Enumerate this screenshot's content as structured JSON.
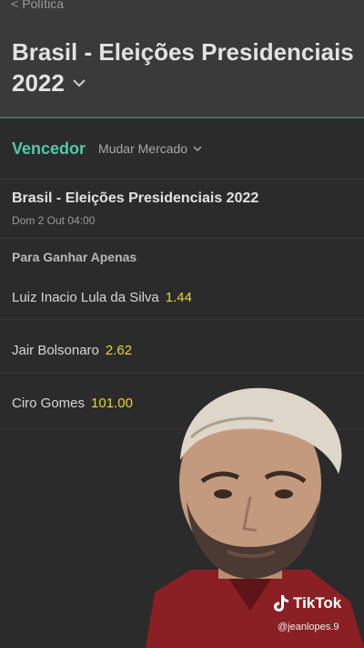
{
  "header": {
    "back_label": "Política",
    "title_line1": "Brasil - Eleições Presidenciais",
    "title_line2": "2022"
  },
  "market": {
    "winner_label": "Vencedor",
    "change_label": "Mudar Mercado"
  },
  "event": {
    "title": "Brasil - Eleições Presidenciais 2022",
    "date": "Dom 2 Out 04:00"
  },
  "section": {
    "label": "Para Ganhar Apenas"
  },
  "selections": [
    {
      "name": "Luiz Inacio Lula da Silva",
      "odds": "1.44"
    },
    {
      "name": "Jair Bolsonaro",
      "odds": "2.62"
    },
    {
      "name": "Ciro Gomes",
      "odds": "101.00"
    }
  ],
  "overlay": {
    "brand": "TikTok",
    "handle": "@jeanlopes.9"
  },
  "colors": {
    "accent": "#52c9a7",
    "odds": "#e9d62e",
    "background": "#2b2b2b",
    "header": "#3a3a3a"
  }
}
